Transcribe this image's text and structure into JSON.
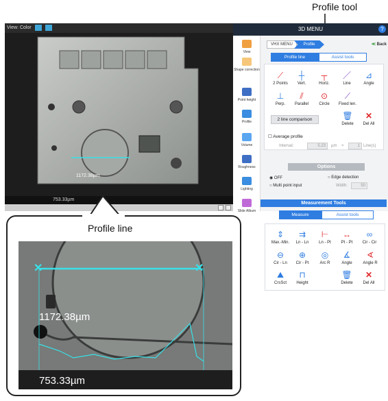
{
  "annotations": {
    "profile_tool": "Profile tool",
    "profile_line": "Profile line"
  },
  "viewer": {
    "label": "View:",
    "color_label": "Color",
    "scale_bar": "753.33µm",
    "measure_label": "1172.38µm"
  },
  "zoom": {
    "measure_label": "1172.38µm",
    "scale_bar": "753.33µm"
  },
  "panel": {
    "title": "3D MENU",
    "help": "?",
    "breadcrumb": {
      "root": "VHX MENU",
      "current": "Profile",
      "back": "Back"
    },
    "tabs": [
      "Profile line",
      "Assist tools"
    ],
    "tools_row1": [
      "2 Points",
      "Vert.",
      "Horiz.",
      "Line",
      "Angle"
    ],
    "tools_row2": [
      "Perp.",
      "Parallel",
      "Circle",
      "Fixed len."
    ],
    "two_line": "2 line comparison",
    "delete": "Delete",
    "del_all": "Del All",
    "average_profile": "Average profile",
    "interval_label": "Interval:",
    "interval_value": "5.23",
    "interval_unit": "µm",
    "times": "×",
    "lines_value": "1",
    "lines_unit": "Line(s)",
    "options_title": "Options",
    "off": "OFF",
    "edge_detection": "Edge detection",
    "multi_point": "Multi point input",
    "width_label": "Width:",
    "width_value": "50",
    "meas_title": "Measurement Tools",
    "meas_tabs": [
      "Measure",
      "Assist tools"
    ],
    "meas_row1": [
      "Max.-Min.",
      "Ln - Ln",
      "Ln - Pt",
      "Pt - Pt",
      "Cir - Cir"
    ],
    "meas_row2": [
      "Cir - Ln",
      "Cir - Pt",
      "Arc R",
      "Angle",
      "Angle R"
    ],
    "meas_row3": [
      "CrsSct",
      "Height",
      "Delete",
      "Del All"
    ]
  },
  "nav": [
    "View",
    "Shape correction",
    "Point height",
    "Profile",
    "Volume",
    "Roughness",
    "Lighting",
    "Slide Album"
  ],
  "colors": {
    "accent": "#2f7de1",
    "cyan": "#38e1e9",
    "danger": "#e0262a",
    "panel_header": "#1f2b3a"
  }
}
